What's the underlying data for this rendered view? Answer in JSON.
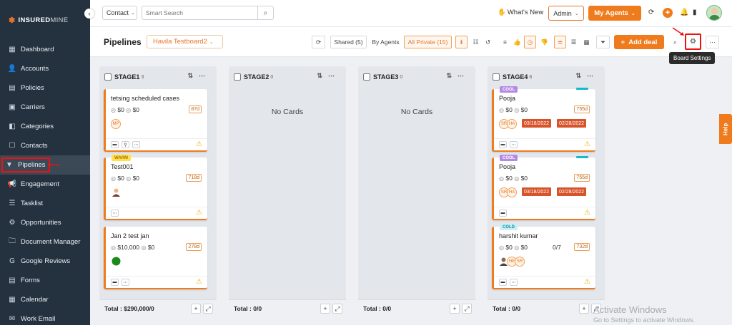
{
  "brand": {
    "mark": "✽",
    "bold": "INSURED",
    "light": "MINE"
  },
  "sidebar": {
    "collapse_glyph": "‹",
    "items": [
      {
        "label": "Dashboard",
        "icon": "▦"
      },
      {
        "label": "Accounts",
        "icon": "👤"
      },
      {
        "label": "Policies",
        "icon": "▤"
      },
      {
        "label": "Carriers",
        "icon": "▣"
      },
      {
        "label": "Categories",
        "icon": "◧"
      },
      {
        "label": "Contacts",
        "icon": "☐"
      },
      {
        "label": "Pipelines",
        "icon": "▼"
      },
      {
        "label": "Engagement",
        "icon": "📢"
      },
      {
        "label": "Tasklist",
        "icon": "☰"
      },
      {
        "label": "Opportunities",
        "icon": "⚙"
      },
      {
        "label": "Document Manager",
        "icon": "🗀"
      },
      {
        "label": "Google Reviews",
        "icon": "G"
      },
      {
        "label": "Forms",
        "icon": "▤"
      },
      {
        "label": "Calendar",
        "icon": "▦"
      },
      {
        "label": "Work Email",
        "icon": "✉"
      }
    ]
  },
  "topbar": {
    "context_select": "Contact",
    "search_placeholder": "Smart Search",
    "whats_new": "What's New",
    "admin": "Admin",
    "my_agents": "My Agents"
  },
  "subbar": {
    "title": "Pipelines",
    "pipeline": "Havila Testboard2",
    "shared": "Shared (5)",
    "by_agents": "By Agents",
    "all_private": "All Private (15)",
    "add_deal": "Add deal",
    "tooltip": "Board Settings"
  },
  "columns": [
    {
      "name": "STAGE1",
      "count": "3",
      "total": "Total : $290,000/0",
      "no_cards": ""
    },
    {
      "name": "STAGE2",
      "count": "0",
      "total": "Total : 0/0",
      "no_cards": "No Cards"
    },
    {
      "name": "STAGE3",
      "count": "0",
      "total": "Total : 0/0",
      "no_cards": "No Cards"
    },
    {
      "name": "STAGE4",
      "count": "6",
      "total": "Total : 0/0",
      "no_cards": ""
    }
  ],
  "cards": {
    "c1": {
      "title": "tetsing scheduled cases",
      "v1": "$0",
      "v2": "$0",
      "days": "87d",
      "ini1": "MP"
    },
    "c2": {
      "tag": "WARM",
      "title": "Test001",
      "v1": "$0",
      "v2": "$0",
      "days": "718d"
    },
    "c3": {
      "title": "Jan 2 test jan",
      "v1": "$10,000",
      "v2": "$0",
      "days": "278d"
    },
    "c4": {
      "tag": "COOL",
      "title": "Pooja",
      "v1": "$0",
      "v2": "$0",
      "days": "755d",
      "ini1": "SR",
      "ini2": "HA",
      "d1": "03/18/2022",
      "d2": "02/28/2022"
    },
    "c5": {
      "tag": "COOL",
      "title": "Pooja",
      "v1": "$0",
      "v2": "$0",
      "days": "755d",
      "ini1": "SR",
      "ini2": "HA",
      "d1": "03/18/2022",
      "d2": "02/28/2022"
    },
    "c6": {
      "tag": "COLD",
      "title": "harshit kumar",
      "v1": "$0",
      "v2": "$0",
      "extra": "0/7",
      "days": "732d",
      "ini1": "HE",
      "ini2": "SR"
    }
  },
  "help": "Help",
  "watermark": {
    "title": "Activate Windows",
    "sub": "Go to Settings to activate Windows."
  },
  "colors": {
    "accent": "#f07b1d",
    "sidebar": "#243240",
    "highlight": "#e11111"
  }
}
